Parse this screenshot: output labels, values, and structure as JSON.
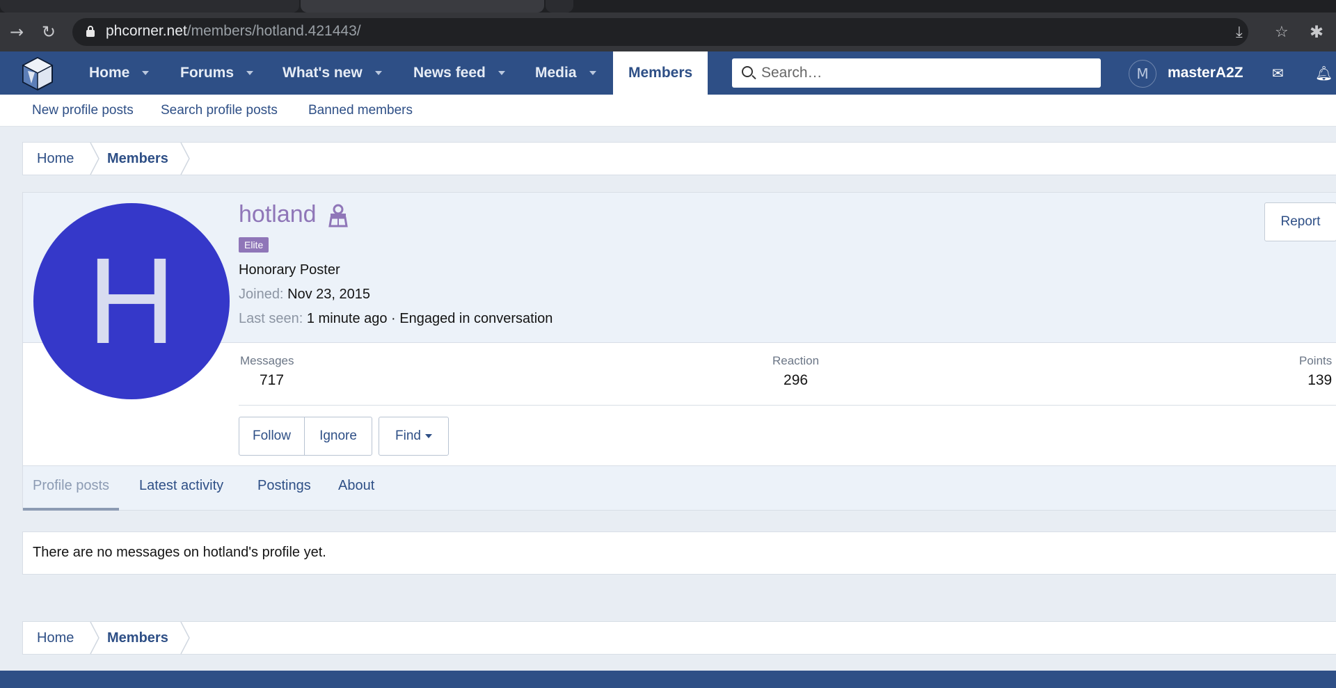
{
  "browser": {
    "url_host": "phcorner.net",
    "url_path": "/members/hotland.421443/"
  },
  "header": {
    "nav": [
      "Home",
      "Forums",
      "What's new",
      "News feed",
      "Media"
    ],
    "active": "Members",
    "search_placeholder": "Search…",
    "avatar_letter": "M",
    "username": "masterA2Z"
  },
  "subnav": [
    "New profile posts",
    "Search profile posts",
    "Banned members"
  ],
  "breadcrumb": [
    "Home",
    "Members"
  ],
  "profile": {
    "avatar_letter": "H",
    "name": "hotland",
    "badge": "Elite",
    "title": "Honorary Poster",
    "joined_label": "Joined:",
    "joined_value": "Nov 23, 2015",
    "lastseen_label": "Last seen:",
    "lastseen_value": "1 minute ago · Engaged in conversation",
    "report": "Report",
    "stats": [
      {
        "label": "Messages",
        "value": "717"
      },
      {
        "label": "Reaction",
        "value": "296"
      },
      {
        "label": "Points",
        "value": "139"
      }
    ],
    "buttons": {
      "follow": "Follow",
      "ignore": "Ignore",
      "find": "Find"
    },
    "tabs": [
      "Profile posts",
      "Latest activity",
      "Postings",
      "About"
    ]
  },
  "messages_empty": "There are no messages on hotland's profile yet.",
  "colors": {
    "header_bg": "#2e4f86",
    "avatar_bg": "#3538c9",
    "username_purple": "#8f76b8"
  }
}
